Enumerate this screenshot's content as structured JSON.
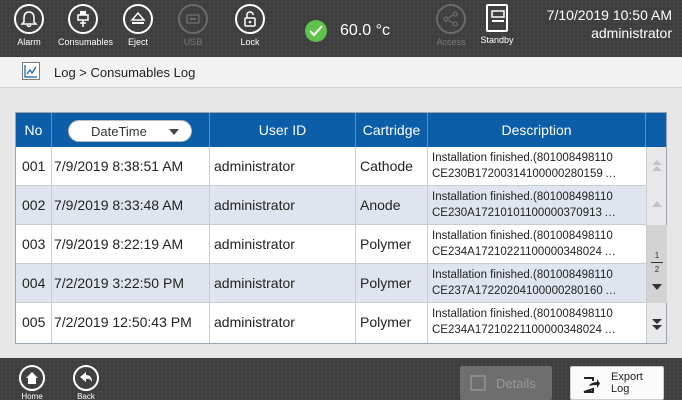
{
  "toolbar": {
    "alarm": "Alarm",
    "consumables": "Consumables",
    "eject": "Eject",
    "usb": "USB",
    "lock": "Lock",
    "temperature": "60.0 °c",
    "access": "Access",
    "standby": "Standby"
  },
  "header": {
    "datetime": "7/10/2019 10:50 AM",
    "user": "administrator"
  },
  "breadcrumb": "Log > Consumables Log",
  "table": {
    "columns": {
      "no": "No",
      "datetime": "DateTime",
      "user_id": "User ID",
      "cartridge": "Cartridge",
      "description": "Description"
    },
    "rows": [
      {
        "no": "001",
        "datetime": "7/9/2019 8:38:51 AM",
        "user": "administrator",
        "cartridge": "Cathode",
        "desc1": "Installation finished.(801008498110",
        "desc2": "CE230B17200314100000280159 …"
      },
      {
        "no": "002",
        "datetime": "7/9/2019 8:33:48 AM",
        "user": "administrator",
        "cartridge": "Anode",
        "desc1": "Installation finished.(801008498110",
        "desc2": "CE230A17210101100000370913 …"
      },
      {
        "no": "003",
        "datetime": "7/9/2019 8:22:19 AM",
        "user": "administrator",
        "cartridge": "Polymer",
        "desc1": "Installation finished.(801008498110",
        "desc2": "CE234A17210221100000348024 …"
      },
      {
        "no": "004",
        "datetime": "7/2/2019 3:22:50 PM",
        "user": "administrator",
        "cartridge": "Polymer",
        "desc1": "Installation finished.(801008498110",
        "desc2": "CE237A17220204100000280160 …"
      },
      {
        "no": "005",
        "datetime": "7/2/2019 12:50:43 PM",
        "user": "administrator",
        "cartridge": "Polymer",
        "desc1": "Installation finished.(801008498110",
        "desc2": "CE234A17210221100000348024 …"
      }
    ]
  },
  "pagination": {
    "current": "1",
    "total": "2"
  },
  "footer": {
    "home": "Home",
    "back": "Back",
    "details": "Details",
    "export_line1": "Export",
    "export_line2": "Log"
  },
  "colors": {
    "header_blue": "#0c5ea8",
    "ok_green": "#5fc24a",
    "bar_dark": "#3e3e3e"
  }
}
